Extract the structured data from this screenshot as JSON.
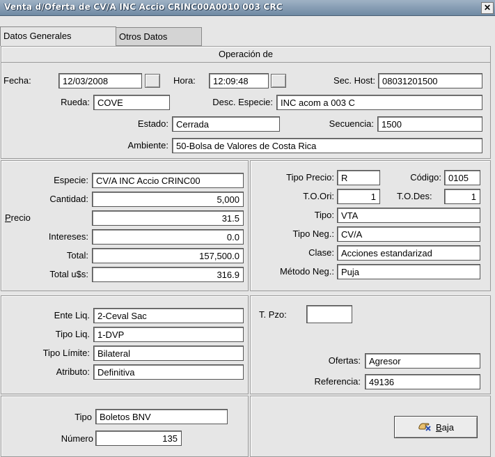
{
  "window": {
    "title": "Venta d/Oferta de CV/A INC Accio CRINC00A0010 003 CRC",
    "close": "✕"
  },
  "tabs": [
    {
      "label": "Datos Generales"
    },
    {
      "label": "Otros Datos"
    }
  ],
  "operacion": {
    "header": "Operación de",
    "fecha_label": "Fecha:",
    "fecha": "12/03/2008",
    "hora_label": "Hora:",
    "hora": "12:09:48",
    "sechost_label": "Sec. Host:",
    "sechost": "08031201500",
    "rueda_label": "Rueda:",
    "rueda": "COVE",
    "descesp_label": "Desc. Especie:",
    "descesp": "INC acom a 003 C",
    "estado_label": "Estado:",
    "estado": "Cerrada",
    "secuencia_label": "Secuencia:",
    "secuencia": "1500",
    "ambiente_label": "Ambiente:",
    "ambiente": "50-Bolsa de Valores de Costa Rica"
  },
  "valores": {
    "especie_label": "Especie:",
    "especie": "CV/A INC Accio CRINC00",
    "cantidad_label": "Cantidad:",
    "cantidad": "5,000",
    "precio_label_u": "P",
    "precio_label_rest": "recio",
    "precio": "31.5",
    "intereses_label": "Intereses:",
    "intereses": "0.0",
    "total_label": "Total:",
    "total": "157,500.0",
    "totalusd_label": "Total u$s:",
    "totalusd": "316.9"
  },
  "tipos": {
    "tipoprecio_label": "Tipo Precio:",
    "tipoprecio": "R",
    "codigo_label": "Código:",
    "codigo": "0105",
    "toori_label": "T.O.Ori:",
    "toori": "1",
    "todes_label": "T.O.Des:",
    "todes": "1",
    "tipo_label": "Tipo:",
    "tipo": "VTA",
    "tiponeg_label": "Tipo Neg.:",
    "tiponeg": "CV/A",
    "clase_label": "Clase:",
    "clase": "Acciones estandarizad",
    "metodo_label": "Método Neg.:",
    "metodo": "Puja"
  },
  "liquidacion": {
    "ente_label": "Ente Liq.",
    "ente": "2-Ceval Sac",
    "tipoliq_label": "Tipo Liq.",
    "tipoliq": "1-DVP",
    "tipolim_label": "Tipo Límite:",
    "tipolim": "Bilateral",
    "atributo_label": "Atributo:",
    "atributo": "Definitiva"
  },
  "plazo": {
    "tpzo_label": "T. Pzo:",
    "tpzo": "",
    "ofertas_label": "Ofertas:",
    "ofertas": "Agresor",
    "referencia_label": "Referencia:",
    "referencia": "49136"
  },
  "boleto": {
    "tipo_label": "Tipo",
    "tipo": "Boletos BNV",
    "numero_label": "Número",
    "numero": "135"
  },
  "baja": {
    "label_u": "B",
    "label_rest": "aja",
    "icon": "delete-hand-icon"
  }
}
